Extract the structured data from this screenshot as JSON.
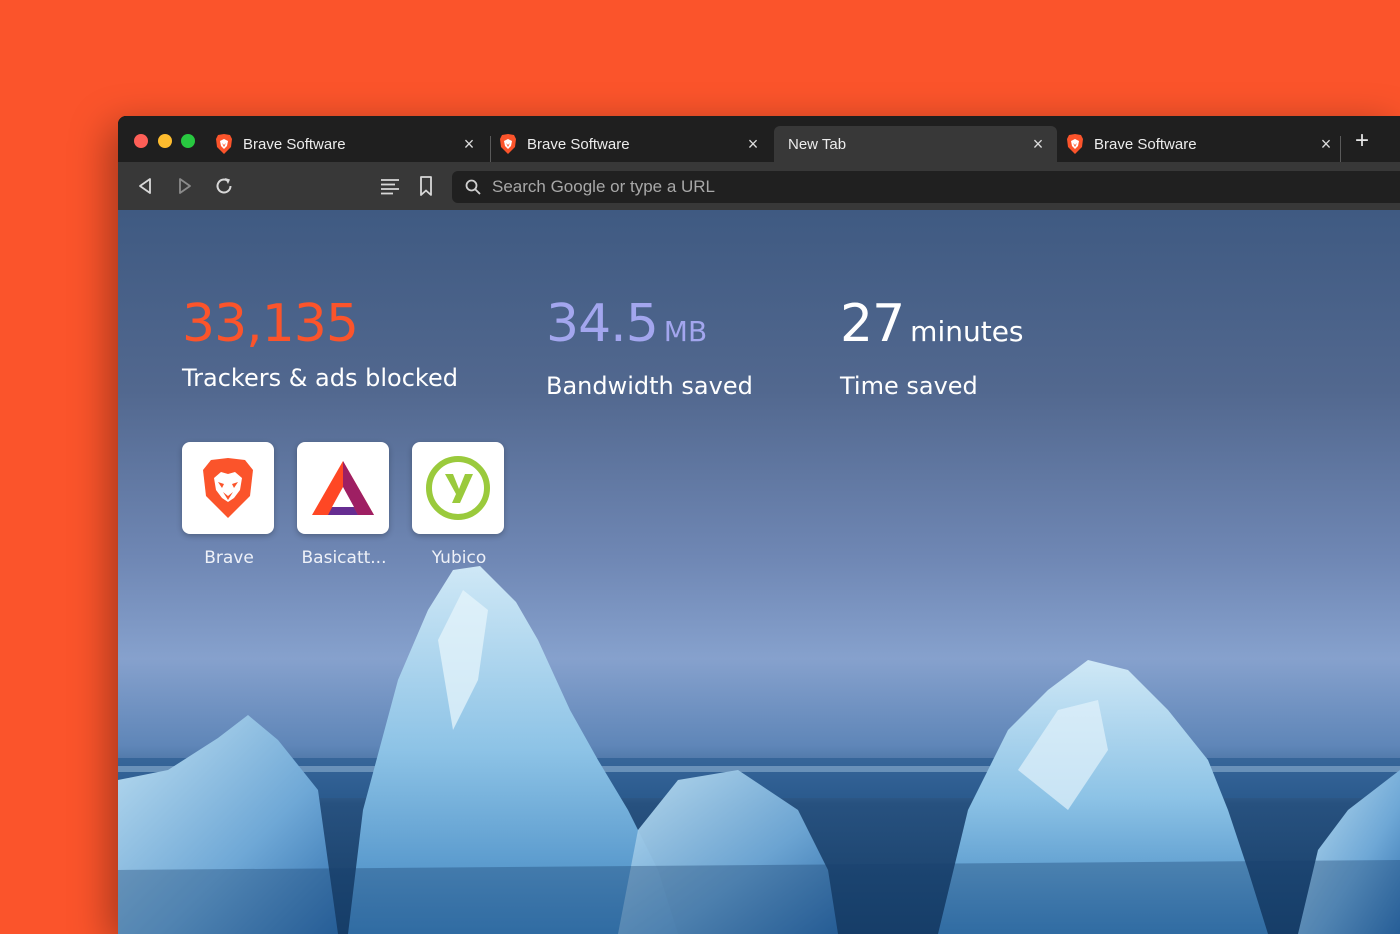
{
  "tabs": [
    {
      "title": "Brave Software",
      "active": false
    },
    {
      "title": "Brave Software",
      "active": false
    },
    {
      "title": "New Tab",
      "active": true
    },
    {
      "title": "Brave Software",
      "active": false
    }
  ],
  "toolbar": {
    "search_placeholder": "Search Google or type a URL"
  },
  "stats": {
    "trackers": {
      "value": "33,135",
      "label": "Trackers & ads blocked"
    },
    "bandwidth": {
      "value": "34.5",
      "unit": "MB",
      "label": "Bandwidth saved"
    },
    "time": {
      "value": "27",
      "unit": "minutes",
      "label": "Time saved"
    }
  },
  "top_sites": [
    {
      "name": "Brave",
      "icon": "brave-lion-icon"
    },
    {
      "name": "Basicatt...",
      "icon": "bat-triangle-icon"
    },
    {
      "name": "Yubico",
      "icon": "yubico-icon"
    }
  ],
  "colors": {
    "brand_orange": "#fb542b",
    "bandwidth_purple": "#a3a6ee",
    "tab_bar": "#1f1f1f",
    "toolbar": "#383838"
  }
}
